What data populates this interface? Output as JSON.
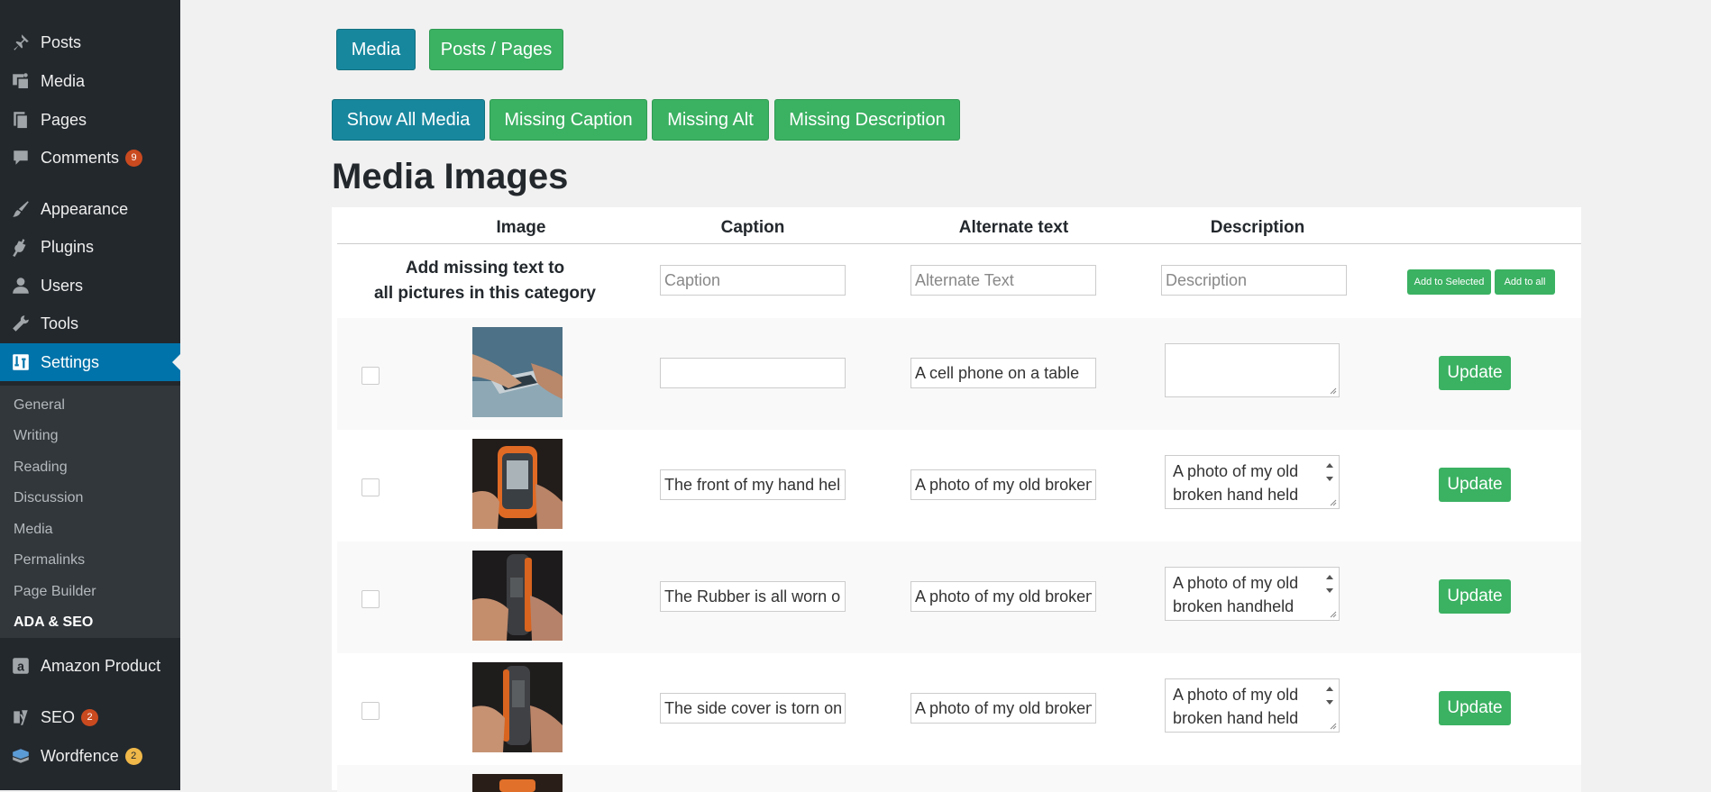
{
  "sidebar": {
    "items": [
      {
        "label": "Posts",
        "icon": "pin-icon",
        "badge": ""
      },
      {
        "label": "Media",
        "icon": "media-icon",
        "badge": ""
      },
      {
        "label": "Pages",
        "icon": "pages-icon",
        "badge": ""
      },
      {
        "label": "Comments",
        "icon": "comment-icon",
        "badge": "9"
      },
      {
        "label": "Appearance",
        "icon": "brush-icon",
        "badge": ""
      },
      {
        "label": "Plugins",
        "icon": "plug-icon",
        "badge": ""
      },
      {
        "label": "Users",
        "icon": "user-icon",
        "badge": ""
      },
      {
        "label": "Tools",
        "icon": "wrench-icon",
        "badge": ""
      },
      {
        "label": "Settings",
        "icon": "settings-icon",
        "badge": ""
      },
      {
        "label": "Amazon Product",
        "icon": "amazon-icon",
        "badge": ""
      },
      {
        "label": "SEO",
        "icon": "yoast-icon",
        "badge": "2"
      },
      {
        "label": "Wordfence",
        "icon": "wordfence-icon",
        "badge": "2"
      }
    ],
    "submenu": [
      "General",
      "Writing",
      "Reading",
      "Discussion",
      "Media",
      "Permalinks",
      "Page Builder",
      "ADA & SEO"
    ]
  },
  "toggle": {
    "media": "Media",
    "posts_pages": "Posts / Pages"
  },
  "filters": {
    "show_all": "Show All Media",
    "missing_caption": "Missing Caption",
    "missing_alt": "Missing Alt",
    "missing_description": "Missing Description"
  },
  "heading": "Media Images",
  "table": {
    "headers": {
      "image": "Image",
      "caption": "Caption",
      "alt": "Alternate text",
      "description": "Description"
    },
    "bulk": {
      "label_line1": "Add missing text to",
      "label_line2": "all pictures in this category",
      "caption_placeholder": "Caption",
      "alt_placeholder": "Alternate Text",
      "description_placeholder": "Description",
      "add_selected": "Add to Selected",
      "add_all": "Add to all"
    },
    "rows": [
      {
        "caption": "",
        "alt": "A cell phone on a table",
        "description": "",
        "update": "Update",
        "image": "hand-phone-table"
      },
      {
        "caption": "The front of my hand held",
        "alt": "A photo of my old broken",
        "description": "A photo of my old broken hand held",
        "update": "Update",
        "image": "gps-front"
      },
      {
        "caption": "The Rubber is all worn ou",
        "alt": "A photo of my old broken",
        "description": "A photo of my old broken handheld",
        "update": "Update",
        "image": "gps-side-1"
      },
      {
        "caption": "The side cover is torn on r",
        "alt": "A photo of my old broken",
        "description": "A photo of my old broken hand held",
        "update": "Update",
        "image": "gps-side-2"
      }
    ]
  },
  "colors": {
    "sidebar": "#23282d",
    "submenu": "#32373c",
    "active": "#0073aa",
    "teal": "#17879e",
    "green": "#3bb162",
    "badge": "#ca4a1f"
  }
}
